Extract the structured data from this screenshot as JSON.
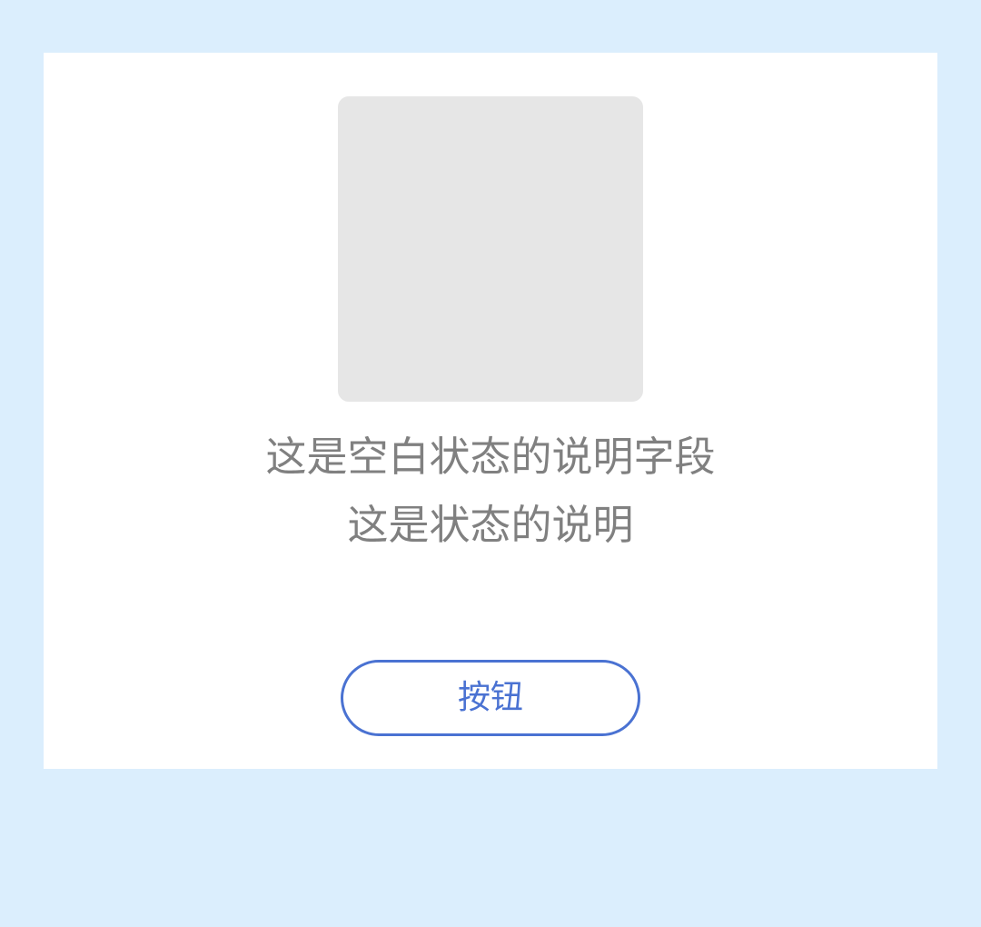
{
  "empty_state": {
    "image": "placeholder-image",
    "description_line_1": "这是空白状态的说明字段",
    "description_line_2": "这是状态的说明",
    "button_label": "按钮"
  },
  "colors": {
    "page_background": "#dbeefd",
    "card_background": "#ffffff",
    "placeholder": "#e6e6e6",
    "text_secondary": "#808080",
    "accent": "#4a72d2"
  }
}
